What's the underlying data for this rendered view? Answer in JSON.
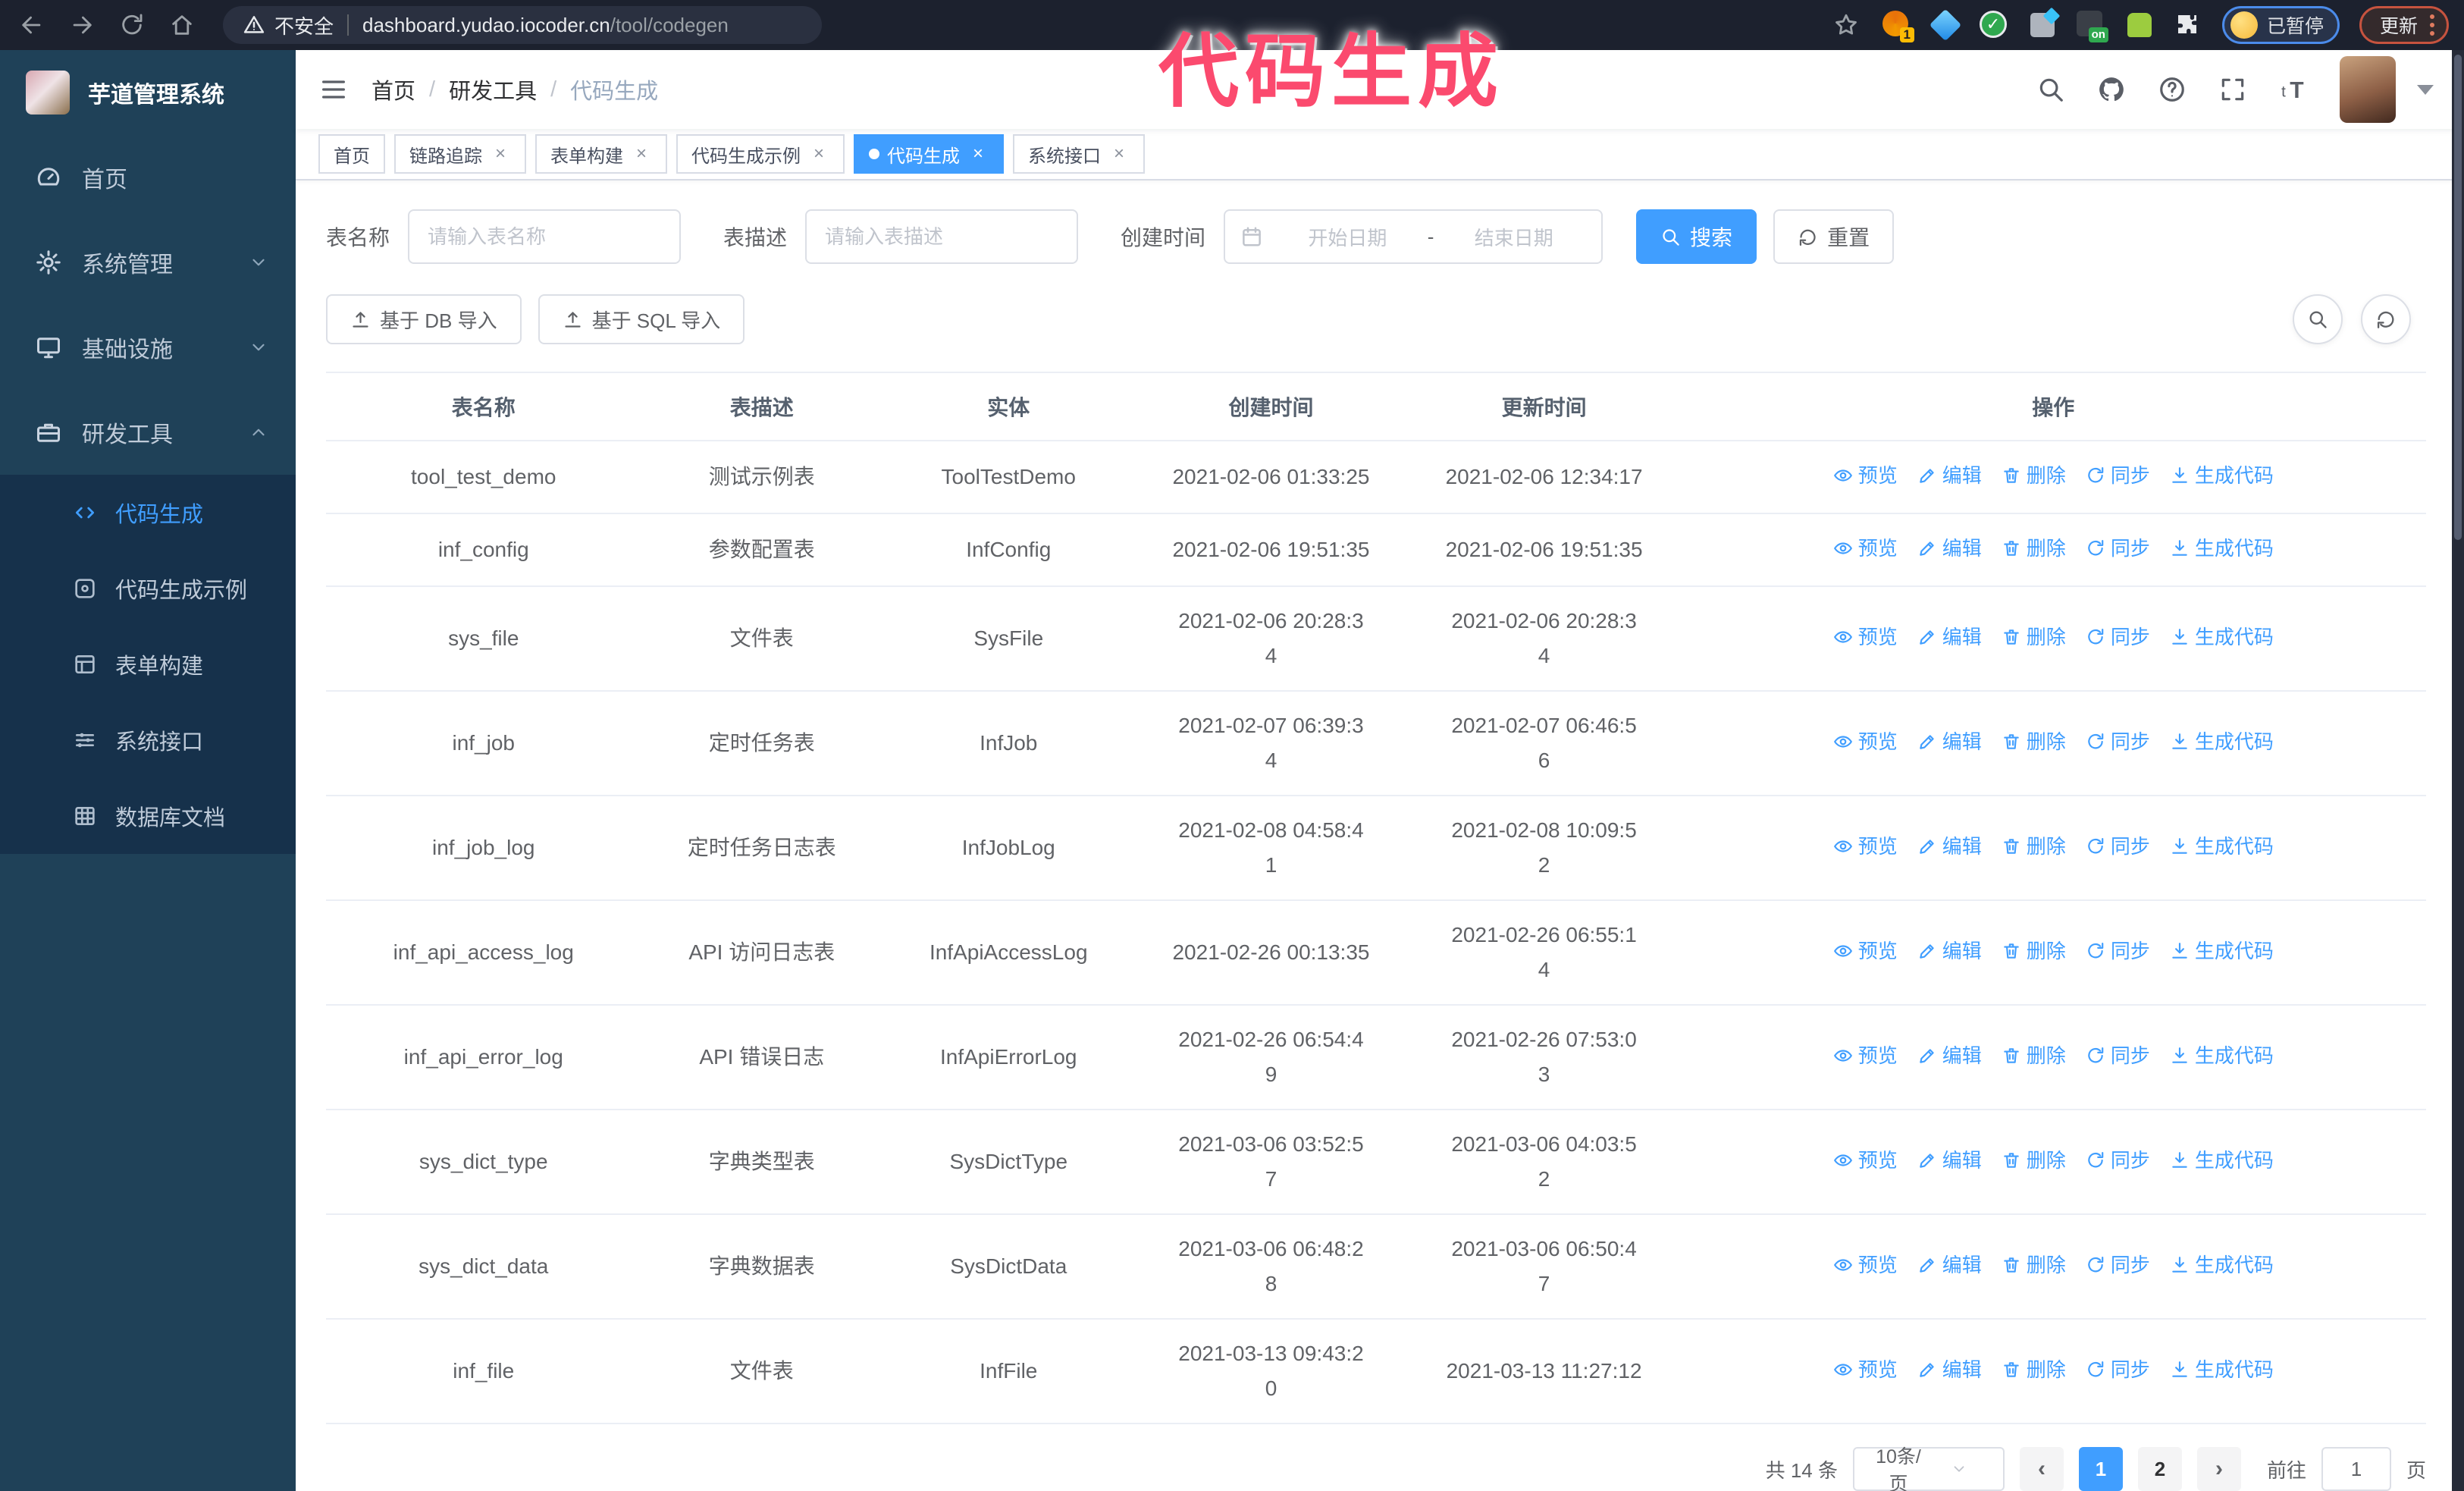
{
  "colors": {
    "accent": "#409eff",
    "annotation_pink": "#fb4a6e",
    "sidebar_bg": "#1f4158",
    "submenu_bg": "#16314b",
    "toolbar_bg": "#1c212e"
  },
  "browser": {
    "security_label": "不安全",
    "url_host": "dashboard.yudao.iocoder.cn",
    "url_path": "/tool/codegen",
    "extension_badge": "1",
    "extension_on_badge": "on",
    "paused_label": "已暂停",
    "update_label": "更新"
  },
  "annotation": {
    "text": "代码生成"
  },
  "sidebar": {
    "title": "芋道管理系统",
    "menu": [
      {
        "label": "首页",
        "icon": "dashboard-icon",
        "chevron": ""
      },
      {
        "label": "系统管理",
        "icon": "gear-icon",
        "chevron": "down"
      },
      {
        "label": "基础设施",
        "icon": "monitor-icon",
        "chevron": "down"
      },
      {
        "label": "研发工具",
        "icon": "toolbox-icon",
        "chevron": "up"
      }
    ],
    "submenu": [
      {
        "label": "代码生成",
        "icon": "code-icon",
        "active": true
      },
      {
        "label": "代码生成示例",
        "icon": "example-icon",
        "active": false
      },
      {
        "label": "表单构建",
        "icon": "form-icon",
        "active": false
      },
      {
        "label": "系统接口",
        "icon": "api-icon",
        "active": false
      },
      {
        "label": "数据库文档",
        "icon": "database-doc-icon",
        "active": false
      }
    ]
  },
  "navbar": {
    "breadcrumb": [
      "首页",
      "研发工具",
      "代码生成"
    ],
    "separator": "/"
  },
  "tabs": [
    {
      "label": "首页",
      "active": false,
      "closable": false
    },
    {
      "label": "链路追踪",
      "active": false,
      "closable": true
    },
    {
      "label": "表单构建",
      "active": false,
      "closable": true
    },
    {
      "label": "代码生成示例",
      "active": false,
      "closable": true
    },
    {
      "label": "代码生成",
      "active": true,
      "closable": true
    },
    {
      "label": "系统接口",
      "active": false,
      "closable": true
    }
  ],
  "filters": {
    "name_label": "表名称",
    "name_placeholder": "请输入表名称",
    "desc_label": "表描述",
    "desc_placeholder": "请输入表描述",
    "time_label": "创建时间",
    "start_placeholder": "开始日期",
    "range_separator": "-",
    "end_placeholder": "结束日期",
    "search_label": "搜索",
    "reset_label": "重置"
  },
  "actions_bar": {
    "db_import_label": "基于 DB 导入",
    "sql_import_label": "基于 SQL 导入"
  },
  "table": {
    "columns": [
      "表名称",
      "表描述",
      "实体",
      "创建时间",
      "更新时间",
      "操作"
    ],
    "row_actions": [
      "预览",
      "编辑",
      "删除",
      "同步",
      "生成代码"
    ],
    "rows": [
      {
        "name": "tool_test_demo",
        "desc": "测试示例表",
        "entity": "ToolTestDemo",
        "created": "2021-02-06 01:33:25",
        "updated": "2021-02-06 12:34:17"
      },
      {
        "name": "inf_config",
        "desc": "参数配置表",
        "entity": "InfConfig",
        "created": "2021-02-06 19:51:35",
        "updated": "2021-02-06 19:51:35"
      },
      {
        "name": "sys_file",
        "desc": "文件表",
        "entity": "SysFile",
        "created": "2021-02-06 20:28:3\n4",
        "updated": "2021-02-06 20:28:3\n4"
      },
      {
        "name": "inf_job",
        "desc": "定时任务表",
        "entity": "InfJob",
        "created": "2021-02-07 06:39:3\n4",
        "updated": "2021-02-07 06:46:5\n6"
      },
      {
        "name": "inf_job_log",
        "desc": "定时任务日志表",
        "entity": "InfJobLog",
        "created": "2021-02-08 04:58:4\n1",
        "updated": "2021-02-08 10:09:5\n2"
      },
      {
        "name": "inf_api_access_log",
        "desc": "API 访问日志表",
        "entity": "InfApiAccessLog",
        "created": "2021-02-26 00:13:35",
        "updated": "2021-02-26 06:55:1\n4"
      },
      {
        "name": "inf_api_error_log",
        "desc": "API 错误日志",
        "entity": "InfApiErrorLog",
        "created": "2021-02-26 06:54:4\n9",
        "updated": "2021-02-26 07:53:0\n3"
      },
      {
        "name": "sys_dict_type",
        "desc": "字典类型表",
        "entity": "SysDictType",
        "created": "2021-03-06 03:52:5\n7",
        "updated": "2021-03-06 04:03:5\n2"
      },
      {
        "name": "sys_dict_data",
        "desc": "字典数据表",
        "entity": "SysDictData",
        "created": "2021-03-06 06:48:2\n8",
        "updated": "2021-03-06 06:50:4\n7"
      },
      {
        "name": "inf_file",
        "desc": "文件表",
        "entity": "InfFile",
        "created": "2021-03-13 09:43:2\n0",
        "updated": "2021-03-13 11:27:12"
      }
    ]
  },
  "pagination": {
    "total_label": "共 14 条",
    "page_size_label": "10条/页",
    "pages": [
      "1",
      "2"
    ],
    "active_page": "1",
    "goto_label": "前往",
    "goto_value": "1",
    "unit_label": "页"
  }
}
